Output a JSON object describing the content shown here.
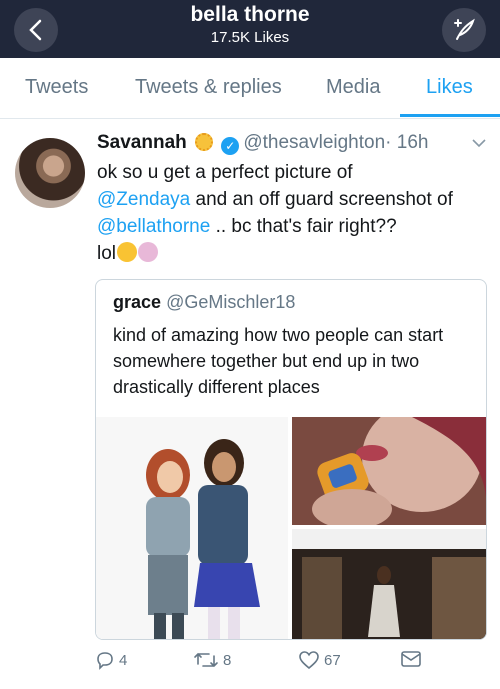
{
  "header": {
    "title": "bella thorne",
    "subtitle": "17.5K Likes"
  },
  "tabs": [
    {
      "label": "Tweets",
      "active": false
    },
    {
      "label": "Tweets & replies",
      "active": false
    },
    {
      "label": "Media",
      "active": false
    },
    {
      "label": "Likes",
      "active": true
    }
  ],
  "tweet": {
    "name": "Savannah",
    "handle": "@thesavleighton",
    "time": "· 16h",
    "body_1": "ok so u get a perfect picture of",
    "mention_1": "@Zendaya",
    "body_2": " and an off guard screenshot of ",
    "mention_2": "@bellathorne",
    "body_3": " .. bc that's fair right??",
    "body_4": "lol"
  },
  "quote": {
    "name": "grace",
    "handle": "@GeMischler18",
    "body": "kind of amazing how two people can start somewhere together but end up in two drastically different places"
  },
  "actions": {
    "replies": "4",
    "retweets": "8",
    "likes": "67"
  },
  "colors": {
    "accent": "#1da1f2",
    "header_bg": "#20273a",
    "muted": "#657786"
  }
}
